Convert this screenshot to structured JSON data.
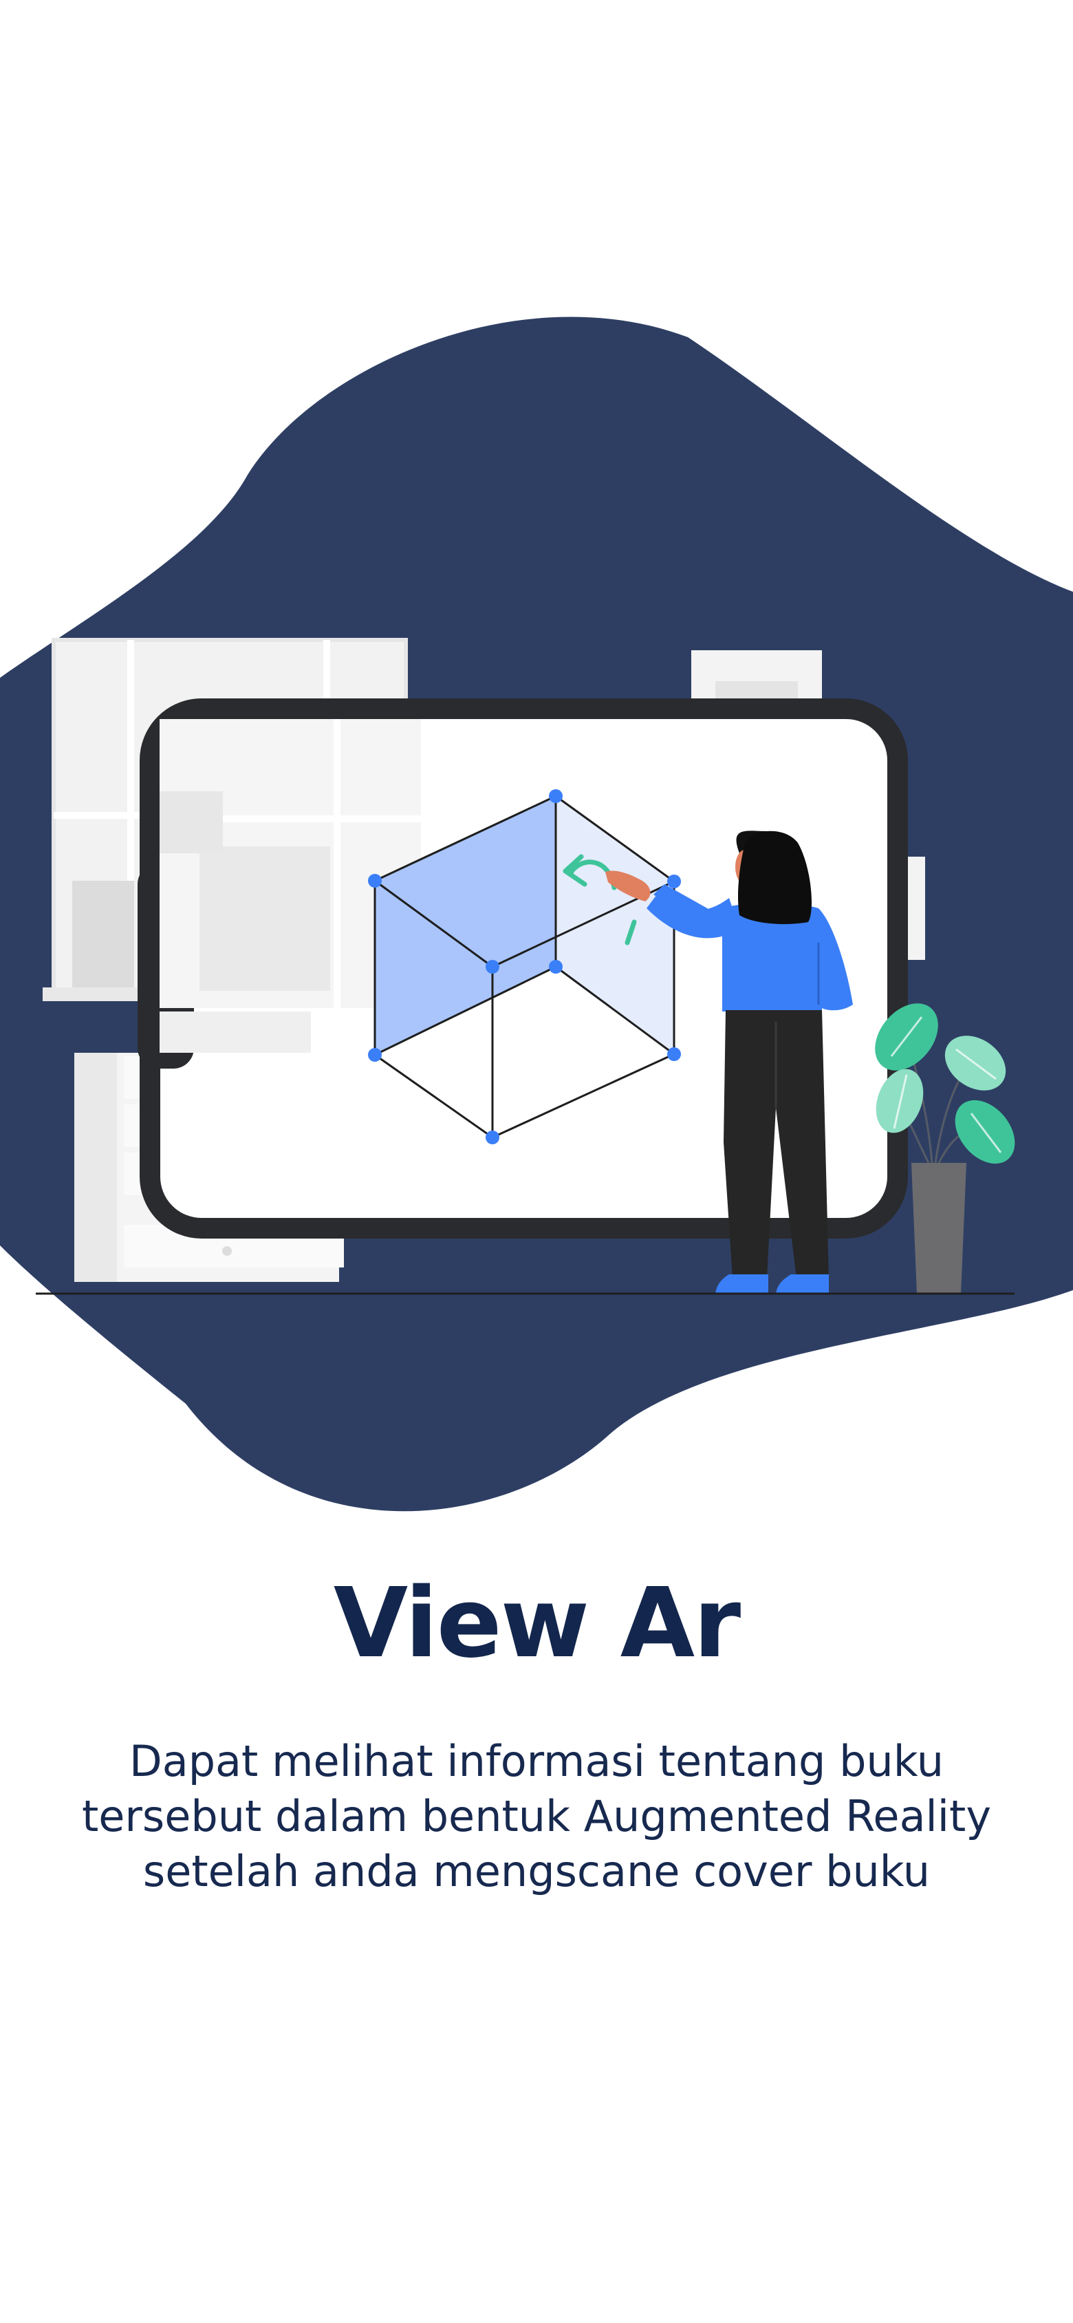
{
  "onboarding": {
    "title": "View Ar",
    "description_lines": [
      "Dapat melihat informasi tentang buku",
      "tersebut dalam bentuk Augmented Reality",
      "setelah anda mengscane cover buku"
    ]
  },
  "illustration": {
    "subject": "woman-interacting-with-ar-cube-on-phone",
    "icons": [
      "phone-frame-icon",
      "ar-cube-icon",
      "rotate-arrow-icon",
      "plant-icon",
      "person-icon"
    ]
  },
  "colors": {
    "blob": "#2e3e63",
    "title": "#13264d",
    "text": "#17294f",
    "accent_blue": "#3a7ff7",
    "accent_green": "#3fc49a",
    "phone_frame": "#2a2b2e"
  }
}
